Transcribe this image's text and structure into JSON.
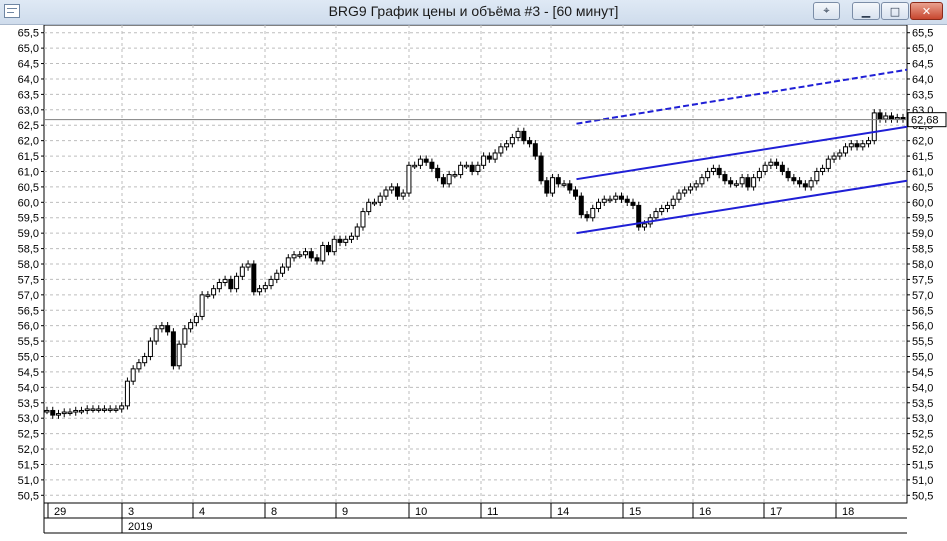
{
  "window": {
    "title": "BRG9 График цены и объёма #3 - [60 минут]",
    "icons": {
      "app": "window-icon",
      "special": "grid-icon",
      "minimize": "minimize-icon",
      "maximize": "maximize-icon",
      "close": "close-icon"
    }
  },
  "chart_data": {
    "type": "candlestick",
    "title": "BRG9 График цены и объёма #3 - [60 минут]",
    "ylim": [
      50.25,
      65.75
    ],
    "y_ticks": [
      "65,5",
      "65,0",
      "64,5",
      "64,0",
      "63,5",
      "63,0",
      "62,5",
      "62,0",
      "61,5",
      "61,0",
      "60,5",
      "60,0",
      "59,5",
      "59,0",
      "58,5",
      "58,0",
      "57,5",
      "57,0",
      "56,5",
      "56,0",
      "55,5",
      "55,0",
      "54,5",
      "54,0",
      "53,5",
      "53,0",
      "52,5",
      "52,0",
      "51,5",
      "51,0",
      "50,5"
    ],
    "x_day_labels": [
      "29",
      "3",
      "4",
      "8",
      "9",
      "10",
      "11",
      "14",
      "15",
      "16",
      "17",
      "18"
    ],
    "year_label": "2019",
    "last_price": 62.68,
    "last_price_label": "62,68",
    "grid": true,
    "close_series": [
      53.25,
      53.1,
      53.15,
      53.2,
      53.2,
      53.25,
      53.25,
      53.3,
      53.3,
      53.3,
      53.3,
      53.3,
      53.3,
      53.4,
      54.2,
      54.6,
      54.8,
      55.0,
      55.5,
      55.9,
      56.0,
      55.8,
      54.7,
      55.4,
      55.9,
      56.1,
      56.3,
      57.0,
      57.0,
      57.2,
      57.4,
      57.5,
      57.2,
      57.6,
      57.9,
      58.0,
      57.1,
      57.2,
      57.3,
      57.5,
      57.7,
      57.9,
      58.2,
      58.3,
      58.3,
      58.4,
      58.2,
      58.1,
      58.6,
      58.4,
      58.8,
      58.7,
      58.8,
      58.9,
      59.2,
      59.7,
      60.0,
      60.0,
      60.2,
      60.4,
      60.5,
      60.2,
      60.3,
      61.2,
      61.2,
      61.4,
      61.3,
      61.1,
      60.8,
      60.6,
      60.9,
      60.9,
      61.2,
      61.2,
      61.0,
      61.2,
      61.5,
      61.4,
      61.6,
      61.8,
      61.9,
      62.1,
      62.3,
      62.0,
      61.9,
      61.5,
      60.7,
      60.3,
      60.8,
      60.6,
      60.6,
      60.4,
      60.2,
      59.6,
      59.5,
      59.8,
      60.0,
      60.1,
      60.1,
      60.2,
      60.1,
      60.0,
      59.9,
      59.2,
      59.3,
      59.5,
      59.7,
      59.8,
      59.9,
      60.1,
      60.3,
      60.4,
      60.5,
      60.6,
      60.8,
      61.0,
      61.1,
      60.9,
      60.7,
      60.6,
      60.6,
      60.8,
      60.5,
      60.8,
      61.0,
      61.2,
      61.3,
      61.2,
      61.0,
      60.8,
      60.7,
      60.6,
      60.5,
      60.7,
      61.0,
      61.1,
      61.4,
      61.5,
      61.6,
      61.8,
      61.9,
      61.8,
      61.9,
      62.0,
      62.9,
      62.7,
      62.8,
      62.7,
      62.75,
      62.7
    ],
    "trend_lines": [
      {
        "style": "solid",
        "color": "#1f1fd6",
        "start": [
          0.617,
          59.0
        ],
        "end": [
          1.0,
          60.7
        ]
      },
      {
        "style": "solid",
        "color": "#1f1fd6",
        "start": [
          0.617,
          60.75
        ],
        "end": [
          1.0,
          62.45
        ]
      },
      {
        "style": "dashed",
        "color": "#1f1fd6",
        "start": [
          0.617,
          62.55
        ],
        "end": [
          1.0,
          64.3
        ]
      }
    ]
  }
}
